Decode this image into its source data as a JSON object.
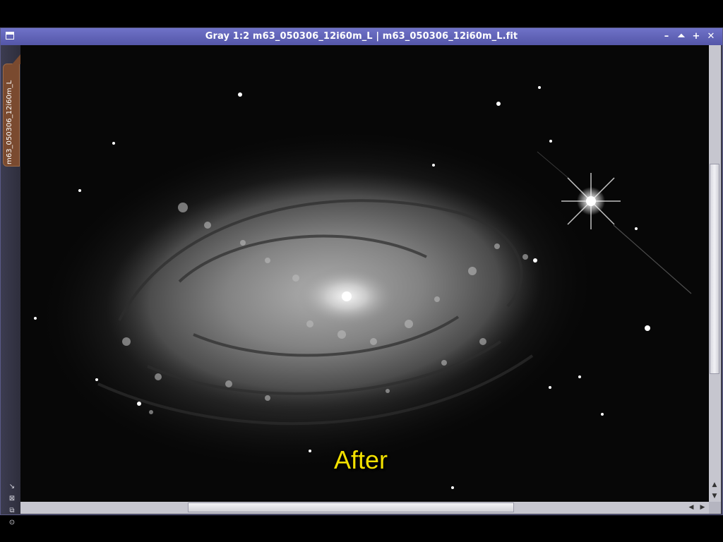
{
  "window": {
    "title": "Gray 1:2 m63_050306_12i60m_L | m63_050306_12i60m_L.fit",
    "buttons": {
      "minimize": "–",
      "shade": "⏶",
      "maximize": "+",
      "close": "✕"
    }
  },
  "image_tab": {
    "label": "m63_050306_12i60m_L"
  },
  "side_tools": [
    {
      "name": "zoom-to-fit-icon",
      "glyph": "↘"
    },
    {
      "name": "fit-window-icon",
      "glyph": "⊠"
    },
    {
      "name": "shrink-window-icon",
      "glyph": "⧉"
    },
    {
      "name": "target-icon",
      "glyph": "⊙"
    }
  ],
  "canvas": {
    "overlay_text": "After"
  },
  "scrollbars": {
    "up_arrow": "▲",
    "down_arrow": "▼",
    "left_arrow": "◀",
    "right_arrow": "▶",
    "vertical_position": 0.25,
    "horizontal_position": 0.47
  },
  "colors": {
    "titlebar": "#5e61b8",
    "overlay_text": "#f2e000",
    "image_tab": "#7a4a2f"
  }
}
